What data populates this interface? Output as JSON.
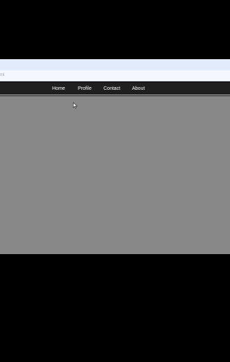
{
  "browser": {
    "address_text": "ml"
  },
  "nav": {
    "items": [
      {
        "label": "Home"
      },
      {
        "label": "Profile"
      },
      {
        "label": "Contact"
      },
      {
        "label": "About"
      }
    ]
  },
  "colors": {
    "navbar_bg": "#1f1f1f",
    "nav_text": "#ffffff",
    "content_bg": "#888888",
    "background": "#000000"
  },
  "icons": {
    "cursor": "mouse-pointer-icon"
  }
}
